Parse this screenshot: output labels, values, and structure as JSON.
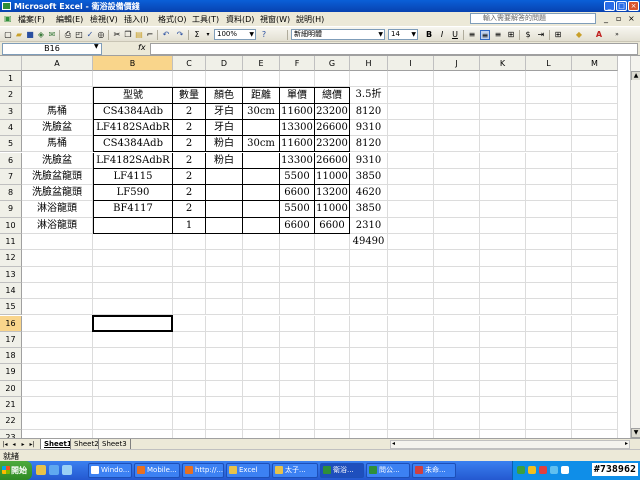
{
  "titlebar": {
    "title": "Microsoft Excel - 衛浴設備價錢"
  },
  "menu": [
    "檔案(F)",
    "編輯(E)",
    "檢視(V)",
    "插入(I)",
    "格式(O)",
    "工具(T)",
    "資料(D)",
    "視窗(W)",
    "說明(H)"
  ],
  "help_placeholder": "輸入需要解答的問題",
  "toolbar": {
    "zoom": "100%",
    "font_name": "新細明體",
    "font_size": "14",
    "bold": "B",
    "italic": "I",
    "underline": "U",
    "sigma": "Σ",
    "currency": "$"
  },
  "formula": {
    "namebox": "B16",
    "fx": "fx"
  },
  "columns": [
    "A",
    "B",
    "C",
    "D",
    "E",
    "F",
    "G",
    "H",
    "I",
    "J",
    "K",
    "L",
    "M"
  ],
  "rows": [
    "1",
    "2",
    "3",
    "4",
    "5",
    "6",
    "7",
    "8",
    "9",
    "10",
    "11",
    "12",
    "13",
    "14",
    "15",
    "16",
    "17",
    "18",
    "19",
    "20",
    "21",
    "22",
    "23"
  ],
  "table": {
    "header": {
      "model": "型號",
      "qty": "數量",
      "color": "顏色",
      "distance": "距離",
      "unit_price": "單價",
      "total": "總價",
      "discount": "3.5折"
    },
    "rows": [
      {
        "name": "馬桶",
        "model": "CS4384Adb",
        "qty": "2",
        "color": "牙白",
        "distance": "30cm",
        "unit_price": "11600",
        "total": "23200",
        "discount": "8120"
      },
      {
        "name": "洗臉盆",
        "model": "LF4182SAdbR",
        "qty": "2",
        "color": "牙白",
        "distance": "",
        "unit_price": "13300",
        "total": "26600",
        "discount": "9310"
      },
      {
        "name": "馬桶",
        "model": "CS4384Adb",
        "qty": "2",
        "color": "粉白",
        "distance": "30cm",
        "unit_price": "11600",
        "total": "23200",
        "discount": "8120"
      },
      {
        "name": "洗臉盆",
        "model": "LF4182SAdbR",
        "qty": "2",
        "color": "粉白",
        "distance": "",
        "unit_price": "13300",
        "total": "26600",
        "discount": "9310"
      },
      {
        "name": "洗臉盆龍頭",
        "model": "LF4115",
        "qty": "2",
        "color": "",
        "distance": "",
        "unit_price": "5500",
        "total": "11000",
        "discount": "3850"
      },
      {
        "name": "洗臉盆龍頭",
        "model": "LF590",
        "qty": "2",
        "color": "",
        "distance": "",
        "unit_price": "6600",
        "total": "13200",
        "discount": "4620"
      },
      {
        "name": "淋浴龍頭",
        "model": "BF4117",
        "qty": "2",
        "color": "",
        "distance": "",
        "unit_price": "5500",
        "total": "11000",
        "discount": "3850"
      },
      {
        "name": "淋浴龍頭",
        "model": "",
        "qty": "1",
        "color": "",
        "distance": "",
        "unit_price": "6600",
        "total": "6600",
        "discount": "2310"
      }
    ],
    "grand_total": "49490"
  },
  "sheets": [
    "Sheet1",
    "Sheet2",
    "Sheet3"
  ],
  "status": "就緒",
  "taskbar": {
    "start": "開始",
    "tasks": [
      "Windo...",
      "Mobile...",
      "http://...",
      "Excel",
      "太子...",
      "衛浴...",
      "問公...",
      "未命..."
    ],
    "watermark": "#738962"
  }
}
